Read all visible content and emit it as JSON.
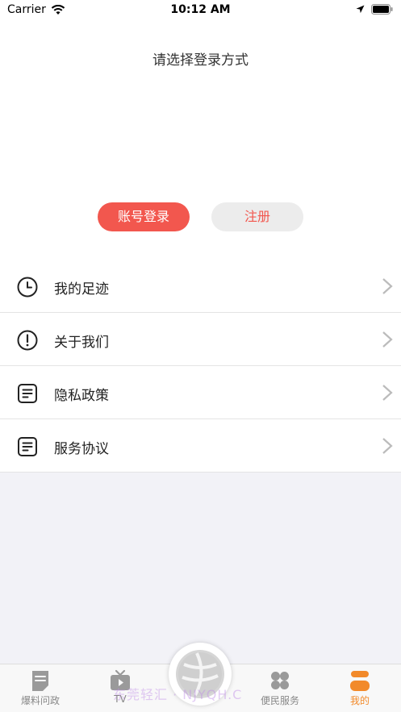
{
  "status_bar": {
    "carrier": "Carrier",
    "time": "10:12 AM"
  },
  "page": {
    "title": "请选择登录方式"
  },
  "buttons": {
    "login": "账号登录",
    "register": "注册"
  },
  "menu": [
    {
      "label": "我的足迹",
      "icon": "clock-icon"
    },
    {
      "label": "关于我们",
      "icon": "info-circle-icon"
    },
    {
      "label": "隐私政策",
      "icon": "document-icon"
    },
    {
      "label": "服务协议",
      "icon": "document-icon"
    }
  ],
  "tabs": [
    {
      "label": "爆料问政",
      "icon": "news-icon",
      "active": false
    },
    {
      "label": "TV",
      "icon": "tv-icon",
      "active": false
    },
    {
      "label": "便民服务",
      "icon": "grid-icon",
      "active": false
    },
    {
      "label": "我的",
      "icon": "profile-icon",
      "active": true
    }
  ],
  "watermark": "东莞轻汇 · NJYQH.C",
  "colors": {
    "accent_red": "#f2574e",
    "accent_orange": "#f28a2a",
    "background": "#f2f2f7"
  }
}
